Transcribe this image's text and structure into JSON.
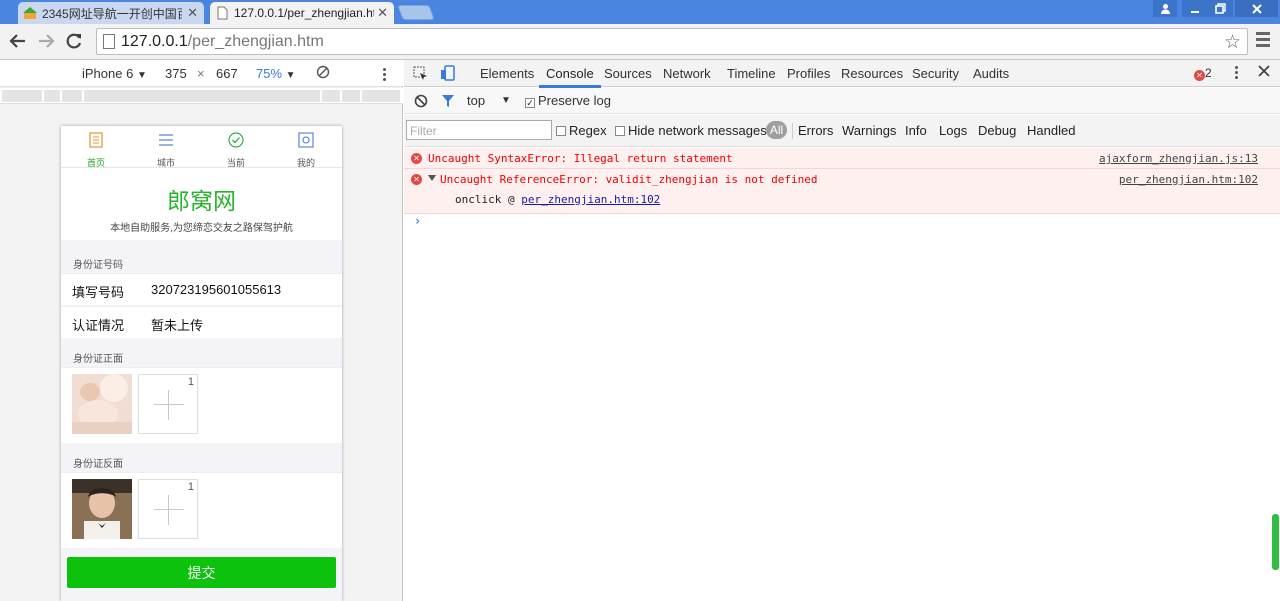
{
  "browser": {
    "tabs": [
      {
        "title": "2345网址导航一开创中国百",
        "active": false
      },
      {
        "title": "127.0.0.1/per_zhengjian.htm",
        "active": true
      }
    ],
    "address": {
      "host": "127.0.0.1",
      "path": "/per_zhengjian.htm"
    }
  },
  "emulation": {
    "device": "iPhone 6",
    "width": "375",
    "times": "×",
    "height": "667",
    "zoom": "75%"
  },
  "page": {
    "nav": [
      {
        "label": "首页",
        "icon": "document-icon",
        "active": true
      },
      {
        "label": "城市",
        "icon": "list-icon",
        "active": false
      },
      {
        "label": "当前",
        "icon": "check-circle-icon",
        "active": false
      },
      {
        "label": "我的",
        "icon": "square-circle-icon",
        "active": false
      }
    ],
    "brand": "郎窝网",
    "slogan": "本地自助服务,为您缔恋交友之路保驾护航",
    "section_id": "身份证号码",
    "rows": [
      {
        "key": "填写号码",
        "value": "320723195601055613"
      },
      {
        "key": "认证情况",
        "value": "暂未上传"
      }
    ],
    "section_front": "身份证正面",
    "section_back": "身份证反面",
    "upload_count": "1",
    "submit": "提交"
  },
  "devtools": {
    "tabs": [
      "Elements",
      "Console",
      "Sources",
      "Network",
      "Timeline",
      "Profiles",
      "Resources",
      "Security",
      "Audits"
    ],
    "active_tab": "Console",
    "error_count": "2",
    "context": "top",
    "preserve_log": "Preserve log",
    "filter_placeholder": "Filter",
    "regex": "Regex",
    "hide_network": "Hide network messages",
    "levels": [
      "All",
      "Errors",
      "Warnings",
      "Info",
      "Logs",
      "Debug",
      "Handled"
    ],
    "messages": [
      {
        "text": "Uncaught SyntaxError: Illegal return statement",
        "source": "ajaxform_zhengjian.js:13"
      },
      {
        "text": "Uncaught ReferenceError: validit_zhengjian is not defined",
        "source": "per_zhengjian.htm:102",
        "stack_fn": "onclick @ ",
        "stack_link": "per_zhengjian.htm:102"
      }
    ],
    "prompt": "›"
  },
  "colors": {
    "accent_green": "#0cc20c",
    "brand_green": "#29b32d",
    "error_red": "#e00",
    "devtools_blue": "#3879d9"
  }
}
